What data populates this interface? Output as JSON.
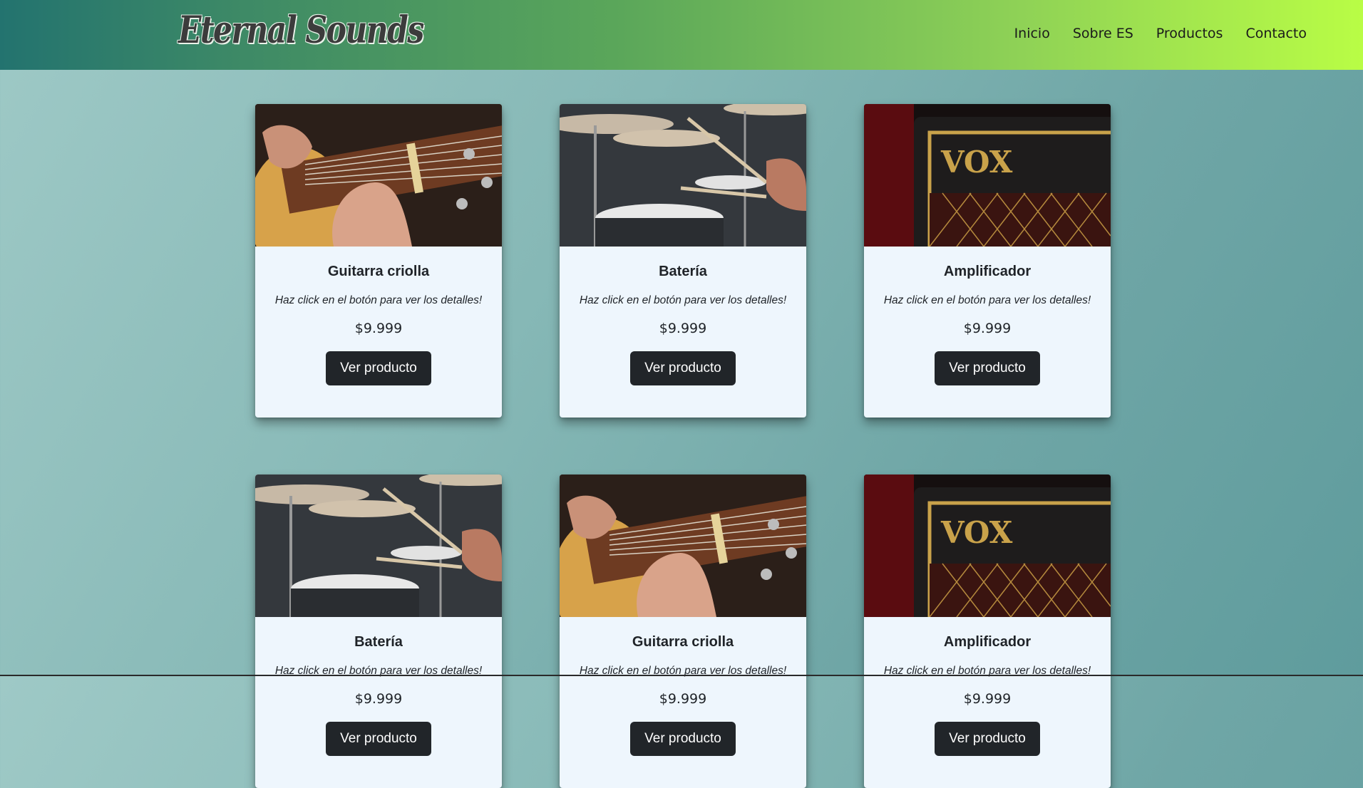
{
  "header": {
    "logo_text": "Eternal Sounds",
    "nav": [
      "Inicio",
      "Sobre ES",
      "Productos",
      "Contacto"
    ]
  },
  "cards": [
    {
      "image": "guitar-photo",
      "title": "Guitarra criolla",
      "desc": "Haz click en el botón para ver los detalles!",
      "price": "$9.999",
      "button": "Ver producto"
    },
    {
      "image": "drums-photo",
      "title": "Batería",
      "desc": "Haz click en el botón para ver los detalles!",
      "price": "$9.999",
      "button": "Ver producto"
    },
    {
      "image": "amp-photo",
      "title": "Amplificador",
      "desc": "Haz click en el botón para ver los detalles!",
      "price": "$9.999",
      "button": "Ver producto"
    },
    {
      "image": "drums-photo",
      "title": "Batería",
      "desc": "Haz click en el botón para ver los detalles!",
      "price": "$9.999",
      "button": "Ver producto"
    },
    {
      "image": "guitar-photo",
      "title": "Guitarra criolla",
      "desc": "Haz click en el botón para ver los detalles!",
      "price": "$9.999",
      "button": "Ver producto"
    },
    {
      "image": "amp-photo",
      "title": "Amplificador",
      "desc": "Haz click en el botón para ver los detalles!",
      "price": "$9.999",
      "button": "Ver producto"
    }
  ],
  "amp_brand_text": "VOX",
  "colors": {
    "header_start": "#23736f",
    "header_end": "#b9fd45",
    "button": "#212529",
    "card_bg": "#eef6fd"
  }
}
